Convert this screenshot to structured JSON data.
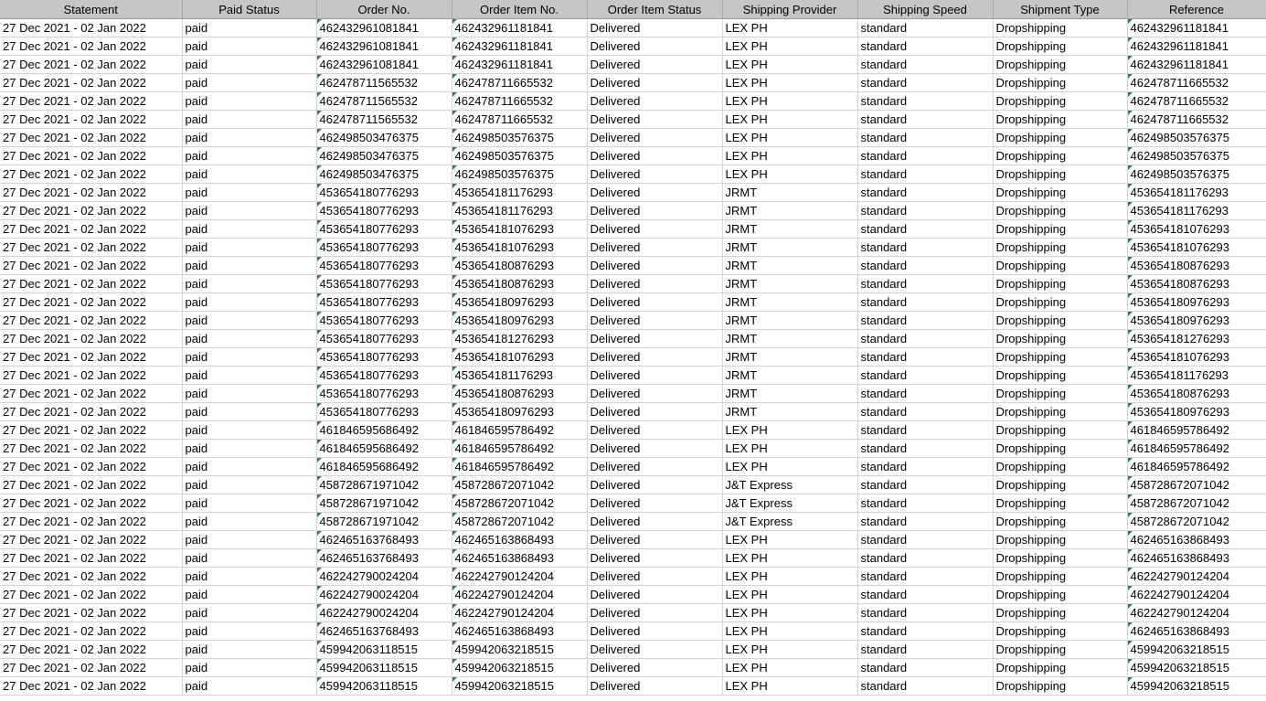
{
  "headers": [
    "Statement",
    "Paid Status",
    "Order No.",
    "Order Item No.",
    "Order Item Status",
    "Shipping Provider",
    "Shipping Speed",
    "Shipment Type",
    "Reference"
  ],
  "rows": [
    [
      "27 Dec 2021 - 02 Jan 2022",
      "paid",
      "462432961081841",
      "462432961181841",
      "Delivered",
      "LEX PH",
      "standard",
      "Dropshipping",
      "462432961181841"
    ],
    [
      "27 Dec 2021 - 02 Jan 2022",
      "paid",
      "462432961081841",
      "462432961181841",
      "Delivered",
      "LEX PH",
      "standard",
      "Dropshipping",
      "462432961181841"
    ],
    [
      "27 Dec 2021 - 02 Jan 2022",
      "paid",
      "462432961081841",
      "462432961181841",
      "Delivered",
      "LEX PH",
      "standard",
      "Dropshipping",
      "462432961181841"
    ],
    [
      "27 Dec 2021 - 02 Jan 2022",
      "paid",
      "462478711565532",
      "462478711665532",
      "Delivered",
      "LEX PH",
      "standard",
      "Dropshipping",
      "462478711665532"
    ],
    [
      "27 Dec 2021 - 02 Jan 2022",
      "paid",
      "462478711565532",
      "462478711665532",
      "Delivered",
      "LEX PH",
      "standard",
      "Dropshipping",
      "462478711665532"
    ],
    [
      "27 Dec 2021 - 02 Jan 2022",
      "paid",
      "462478711565532",
      "462478711665532",
      "Delivered",
      "LEX PH",
      "standard",
      "Dropshipping",
      "462478711665532"
    ],
    [
      "27 Dec 2021 - 02 Jan 2022",
      "paid",
      "462498503476375",
      "462498503576375",
      "Delivered",
      "LEX PH",
      "standard",
      "Dropshipping",
      "462498503576375"
    ],
    [
      "27 Dec 2021 - 02 Jan 2022",
      "paid",
      "462498503476375",
      "462498503576375",
      "Delivered",
      "LEX PH",
      "standard",
      "Dropshipping",
      "462498503576375"
    ],
    [
      "27 Dec 2021 - 02 Jan 2022",
      "paid",
      "462498503476375",
      "462498503576375",
      "Delivered",
      "LEX PH",
      "standard",
      "Dropshipping",
      "462498503576375"
    ],
    [
      "27 Dec 2021 - 02 Jan 2022",
      "paid",
      "453654180776293",
      "453654181176293",
      "Delivered",
      "JRMT",
      "standard",
      "Dropshipping",
      "453654181176293"
    ],
    [
      "27 Dec 2021 - 02 Jan 2022",
      "paid",
      "453654180776293",
      "453654181176293",
      "Delivered",
      "JRMT",
      "standard",
      "Dropshipping",
      "453654181176293"
    ],
    [
      "27 Dec 2021 - 02 Jan 2022",
      "paid",
      "453654180776293",
      "453654181076293",
      "Delivered",
      "JRMT",
      "standard",
      "Dropshipping",
      "453654181076293"
    ],
    [
      "27 Dec 2021 - 02 Jan 2022",
      "paid",
      "453654180776293",
      "453654181076293",
      "Delivered",
      "JRMT",
      "standard",
      "Dropshipping",
      "453654181076293"
    ],
    [
      "27 Dec 2021 - 02 Jan 2022",
      "paid",
      "453654180776293",
      "453654180876293",
      "Delivered",
      "JRMT",
      "standard",
      "Dropshipping",
      "453654180876293"
    ],
    [
      "27 Dec 2021 - 02 Jan 2022",
      "paid",
      "453654180776293",
      "453654180876293",
      "Delivered",
      "JRMT",
      "standard",
      "Dropshipping",
      "453654180876293"
    ],
    [
      "27 Dec 2021 - 02 Jan 2022",
      "paid",
      "453654180776293",
      "453654180976293",
      "Delivered",
      "JRMT",
      "standard",
      "Dropshipping",
      "453654180976293"
    ],
    [
      "27 Dec 2021 - 02 Jan 2022",
      "paid",
      "453654180776293",
      "453654180976293",
      "Delivered",
      "JRMT",
      "standard",
      "Dropshipping",
      "453654180976293"
    ],
    [
      "27 Dec 2021 - 02 Jan 2022",
      "paid",
      "453654180776293",
      "453654181276293",
      "Delivered",
      "JRMT",
      "standard",
      "Dropshipping",
      "453654181276293"
    ],
    [
      "27 Dec 2021 - 02 Jan 2022",
      "paid",
      "453654180776293",
      "453654181076293",
      "Delivered",
      "JRMT",
      "standard",
      "Dropshipping",
      "453654181076293"
    ],
    [
      "27 Dec 2021 - 02 Jan 2022",
      "paid",
      "453654180776293",
      "453654181176293",
      "Delivered",
      "JRMT",
      "standard",
      "Dropshipping",
      "453654181176293"
    ],
    [
      "27 Dec 2021 - 02 Jan 2022",
      "paid",
      "453654180776293",
      "453654180876293",
      "Delivered",
      "JRMT",
      "standard",
      "Dropshipping",
      "453654180876293"
    ],
    [
      "27 Dec 2021 - 02 Jan 2022",
      "paid",
      "453654180776293",
      "453654180976293",
      "Delivered",
      "JRMT",
      "standard",
      "Dropshipping",
      "453654180976293"
    ],
    [
      "27 Dec 2021 - 02 Jan 2022",
      "paid",
      "461846595686492",
      "461846595786492",
      "Delivered",
      "LEX PH",
      "standard",
      "Dropshipping",
      "461846595786492"
    ],
    [
      "27 Dec 2021 - 02 Jan 2022",
      "paid",
      "461846595686492",
      "461846595786492",
      "Delivered",
      "LEX PH",
      "standard",
      "Dropshipping",
      "461846595786492"
    ],
    [
      "27 Dec 2021 - 02 Jan 2022",
      "paid",
      "461846595686492",
      "461846595786492",
      "Delivered",
      "LEX PH",
      "standard",
      "Dropshipping",
      "461846595786492"
    ],
    [
      "27 Dec 2021 - 02 Jan 2022",
      "paid",
      "458728671971042",
      "458728672071042",
      "Delivered",
      "J&T Express",
      "standard",
      "Dropshipping",
      "458728672071042"
    ],
    [
      "27 Dec 2021 - 02 Jan 2022",
      "paid",
      "458728671971042",
      "458728672071042",
      "Delivered",
      "J&T Express",
      "standard",
      "Dropshipping",
      "458728672071042"
    ],
    [
      "27 Dec 2021 - 02 Jan 2022",
      "paid",
      "458728671971042",
      "458728672071042",
      "Delivered",
      "J&T Express",
      "standard",
      "Dropshipping",
      "458728672071042"
    ],
    [
      "27 Dec 2021 - 02 Jan 2022",
      "paid",
      "462465163768493",
      "462465163868493",
      "Delivered",
      "LEX PH",
      "standard",
      "Dropshipping",
      "462465163868493"
    ],
    [
      "27 Dec 2021 - 02 Jan 2022",
      "paid",
      "462465163768493",
      "462465163868493",
      "Delivered",
      "LEX PH",
      "standard",
      "Dropshipping",
      "462465163868493"
    ],
    [
      "27 Dec 2021 - 02 Jan 2022",
      "paid",
      "462242790024204",
      "462242790124204",
      "Delivered",
      "LEX PH",
      "standard",
      "Dropshipping",
      "462242790124204"
    ],
    [
      "27 Dec 2021 - 02 Jan 2022",
      "paid",
      "462242790024204",
      "462242790124204",
      "Delivered",
      "LEX PH",
      "standard",
      "Dropshipping",
      "462242790124204"
    ],
    [
      "27 Dec 2021 - 02 Jan 2022",
      "paid",
      "462242790024204",
      "462242790124204",
      "Delivered",
      "LEX PH",
      "standard",
      "Dropshipping",
      "462242790124204"
    ],
    [
      "27 Dec 2021 - 02 Jan 2022",
      "paid",
      "462465163768493",
      "462465163868493",
      "Delivered",
      "LEX PH",
      "standard",
      "Dropshipping",
      "462465163868493"
    ],
    [
      "27 Dec 2021 - 02 Jan 2022",
      "paid",
      "459942063118515",
      "459942063218515",
      "Delivered",
      "LEX PH",
      "standard",
      "Dropshipping",
      "459942063218515"
    ],
    [
      "27 Dec 2021 - 02 Jan 2022",
      "paid",
      "459942063118515",
      "459942063218515",
      "Delivered",
      "LEX PH",
      "standard",
      "Dropshipping",
      "459942063218515"
    ],
    [
      "27 Dec 2021 - 02 Jan 2022",
      "paid",
      "459942063118515",
      "459942063218515",
      "Delivered",
      "LEX PH",
      "standard",
      "Dropshipping",
      "459942063218515"
    ]
  ],
  "colors": {
    "header_bg": "#c6c6c6",
    "grid_line": "#d4d4d4",
    "text_as_number_marker": "#1e8e3e"
  }
}
